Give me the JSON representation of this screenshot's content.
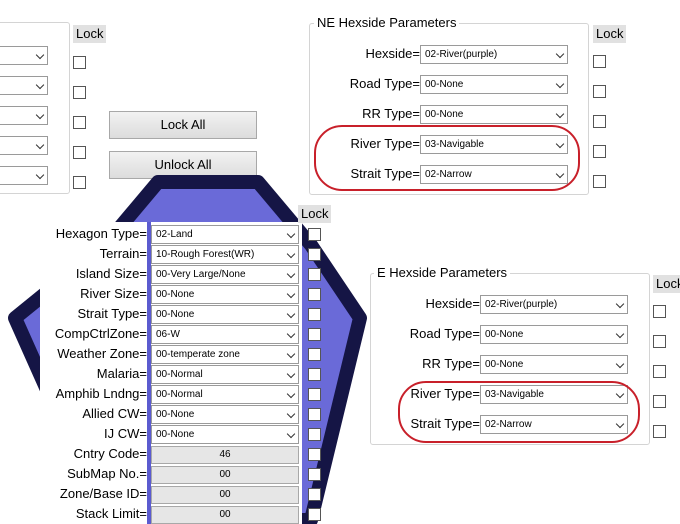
{
  "lock_label": "Lock",
  "buttons": {
    "lock_all": "Lock All",
    "unlock_all": "Unlock All"
  },
  "ne_panel": {
    "title": "NE Hexside Parameters",
    "fields": [
      {
        "label": "Hexside=",
        "value": "02-River(purple)"
      },
      {
        "label": "Road Type=",
        "value": "00-None"
      },
      {
        "label": "RR Type=",
        "value": "00-None"
      },
      {
        "label": "River Type=",
        "value": "03-Navigable"
      },
      {
        "label": "Strait Type=",
        "value": "02-Narrow"
      }
    ]
  },
  "e_panel": {
    "title": "E Hexside Parameters",
    "fields": [
      {
        "label": "Hexside=",
        "value": "02-River(purple)"
      },
      {
        "label": "Road Type=",
        "value": "00-None"
      },
      {
        "label": "RR Type=",
        "value": "00-None"
      },
      {
        "label": "River Type=",
        "value": "03-Navigable"
      },
      {
        "label": "Strait Type=",
        "value": "02-Narrow"
      }
    ]
  },
  "hex_panel": {
    "fields": [
      {
        "label": "Hexagon Type=",
        "value": "02-Land"
      },
      {
        "label": "Terrain=",
        "value": "10-Rough Forest(WR)"
      },
      {
        "label": "Island Size=",
        "value": "00-Very Large/None"
      },
      {
        "label": "River Size=",
        "value": "00-None"
      },
      {
        "label": "Strait Type=",
        "value": "00-None"
      },
      {
        "label": "CompCtrlZone=",
        "value": "06-W"
      },
      {
        "label": "Weather Zone=",
        "value": "00-temperate zone"
      },
      {
        "label": "Malaria=",
        "value": "00-Normal"
      },
      {
        "label": "Amphib Lndng=",
        "value": "00-Normal"
      },
      {
        "label": "Allied CW=",
        "value": "00-None"
      },
      {
        "label": "IJ CW=",
        "value": "00-None"
      }
    ],
    "numeric": [
      {
        "label": "Cntry Code=",
        "value": "46"
      },
      {
        "label": "SubMap No.=",
        "value": "00"
      },
      {
        "label": "Zone/Base ID=",
        "value": "00"
      },
      {
        "label": "Stack Limit=",
        "value": "00"
      }
    ]
  },
  "colors": {
    "hex_fill": "#6a6ad8",
    "hex_border": "#151545",
    "highlight_ring": "#c8202a"
  }
}
